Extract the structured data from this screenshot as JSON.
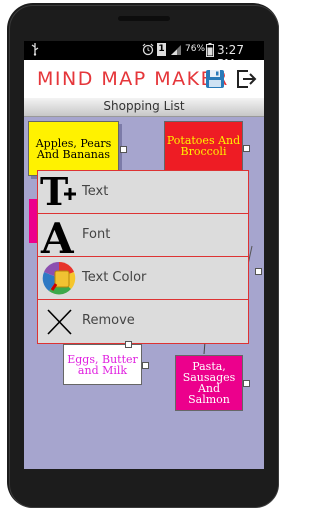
{
  "status_bar": {
    "battery": "76%",
    "time": "3:27 PM",
    "sim_badge": "1",
    "icons": [
      "usb-icon",
      "alarm-icon",
      "sim-icon",
      "signal-icon",
      "battery-icon"
    ]
  },
  "app": {
    "title": "MIND MAP MAKER",
    "toolbar_icons": [
      "save-icon",
      "exit-icon"
    ]
  },
  "map": {
    "name": "Shopping List",
    "nodes": [
      {
        "label": "Apples, Pears And Bananas",
        "bg": "#fff200",
        "color": "#000000"
      },
      {
        "label": "Potatoes And Broccoli",
        "bg": "#ee1c24",
        "color": "#fff200"
      },
      {
        "label": "Eggs, Butter and Milk",
        "bg": "#ffffff",
        "color": "#e020e0"
      },
      {
        "label": "Pasta, Sausages And Salmon",
        "bg": "#ec008c",
        "color": "#ffffff"
      }
    ]
  },
  "menu": {
    "items": [
      {
        "label": "Text",
        "icon": "text-add-icon"
      },
      {
        "label": "Font",
        "icon": "font-icon"
      },
      {
        "label": "Text Color",
        "icon": "paint-bucket-icon"
      },
      {
        "label": "Remove",
        "icon": "close-icon"
      }
    ]
  }
}
